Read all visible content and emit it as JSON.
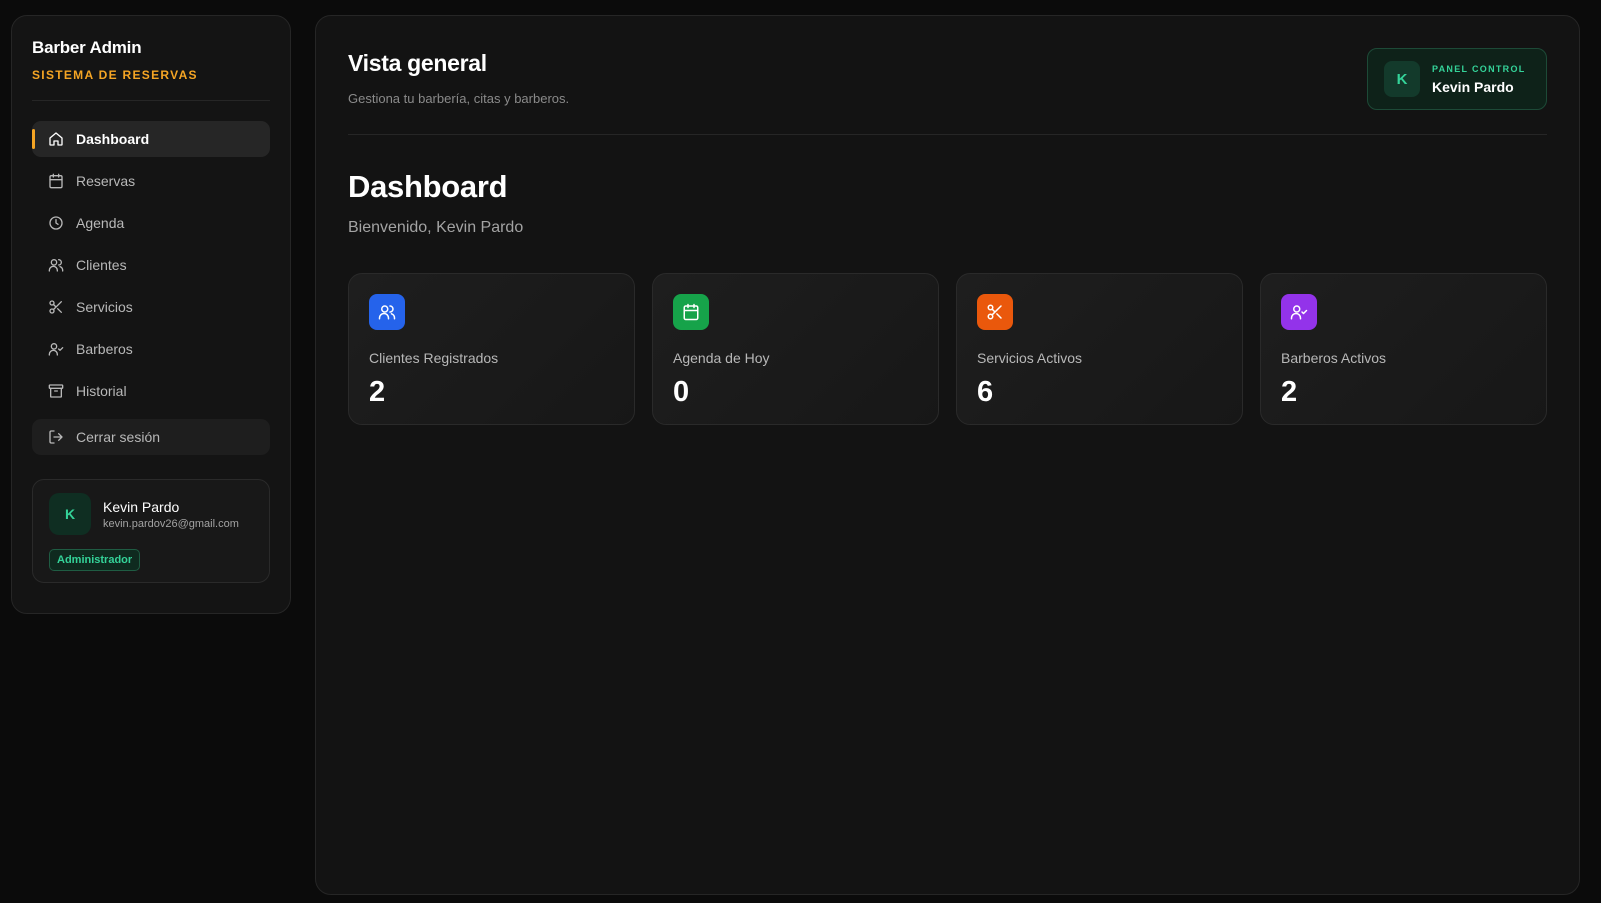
{
  "sidebar": {
    "brand_title": "Barber Admin",
    "brand_subtitle": "SISTEMA DE RESERVAS",
    "items": [
      {
        "label": "Dashboard",
        "icon": "home-icon",
        "active": true
      },
      {
        "label": "Reservas",
        "icon": "calendar-icon"
      },
      {
        "label": "Agenda",
        "icon": "clock-icon"
      },
      {
        "label": "Clientes",
        "icon": "users-icon"
      },
      {
        "label": "Servicios",
        "icon": "scissors-icon"
      },
      {
        "label": "Barberos",
        "icon": "user-check-icon"
      },
      {
        "label": "Historial",
        "icon": "archive-icon"
      }
    ],
    "logout_label": "Cerrar sesión",
    "user": {
      "initial": "K",
      "name": "Kevin Pardo",
      "email": "kevin.pardov26@gmail.com",
      "role": "Administrador"
    }
  },
  "header": {
    "title": "Vista general",
    "subtitle": "Gestiona tu barbería, citas y barberos.",
    "badge": {
      "initial": "K",
      "label": "PANEL CONTROL",
      "name": "Kevin Pardo"
    }
  },
  "main": {
    "title": "Dashboard",
    "welcome": "Bienvenido, Kevin Pardo",
    "stats": [
      {
        "label": "Clientes Registrados",
        "value": "2",
        "icon": "users-icon",
        "color": "#2563eb"
      },
      {
        "label": "Agenda de Hoy",
        "value": "0",
        "icon": "calendar-icon",
        "color": "#16a34a"
      },
      {
        "label": "Servicios Activos",
        "value": "6",
        "icon": "scissors-icon",
        "color": "#ea580c"
      },
      {
        "label": "Barberos Activos",
        "value": "2",
        "icon": "user-check-icon",
        "color": "#9333ea"
      }
    ]
  },
  "colors": {
    "accent": "#f5a524",
    "success": "#34d399"
  }
}
